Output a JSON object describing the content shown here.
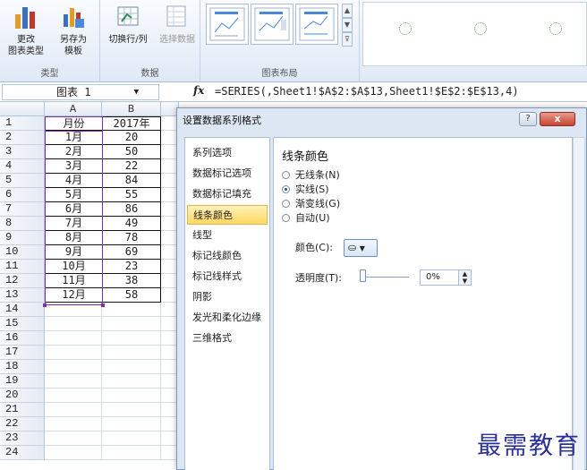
{
  "ribbon": {
    "groups": [
      {
        "label": "类型",
        "buttons": [
          {
            "label": "更改\n图表类型"
          },
          {
            "label": "另存为\n模板"
          }
        ]
      },
      {
        "label": "数据",
        "buttons": [
          {
            "label": "切换行/列"
          },
          {
            "label": "选择数据"
          }
        ]
      },
      {
        "label": "图表布局"
      }
    ]
  },
  "formula_bar": {
    "name_box": "图表 1",
    "fx_label": "fx",
    "formula": "=SERIES(,Sheet1!$A$2:$A$13,Sheet1!$E$2:$E$13,4)"
  },
  "sheet": {
    "columns": [
      "A",
      "B"
    ],
    "header_row": [
      "月份",
      "2017年"
    ],
    "rows": [
      [
        "1月",
        "20"
      ],
      [
        "2月",
        "50"
      ],
      [
        "3月",
        "22"
      ],
      [
        "4月",
        "84"
      ],
      [
        "5月",
        "55"
      ],
      [
        "6月",
        "86"
      ],
      [
        "7月",
        "49"
      ],
      [
        "8月",
        "78"
      ],
      [
        "9月",
        "69"
      ],
      [
        "10月",
        "23"
      ],
      [
        "11月",
        "38"
      ],
      [
        "12月",
        "58"
      ]
    ],
    "row_numbers": [
      "1",
      "2",
      "3",
      "4",
      "5",
      "6",
      "7",
      "8",
      "9",
      "10",
      "11",
      "12",
      "13",
      "14",
      "15",
      "16",
      "17",
      "18",
      "19",
      "20",
      "21",
      "22",
      "23",
      "24"
    ]
  },
  "dialog": {
    "title": "设置数据系列格式",
    "help": "?",
    "close": "x",
    "nav": [
      "系列选项",
      "数据标记选项",
      "数据标记填充",
      "线条颜色",
      "线型",
      "标记线颜色",
      "标记线样式",
      "阴影",
      "发光和柔化边缘",
      "三维格式"
    ],
    "active_index": 3,
    "section_title": "线条颜色",
    "options": [
      {
        "label": "无线条(N)",
        "checked": false
      },
      {
        "label": "实线(S)",
        "checked": true
      },
      {
        "label": "渐变线(G)",
        "checked": false
      },
      {
        "label": "自动(U)",
        "checked": false
      }
    ],
    "color_label": "颜色(C):",
    "transparency_label": "透明度(T):",
    "transparency_value": "0%"
  },
  "watermark": "最需教育",
  "colors": {
    "selection": "#7a2fb0",
    "active_nav": "#ffd863"
  }
}
